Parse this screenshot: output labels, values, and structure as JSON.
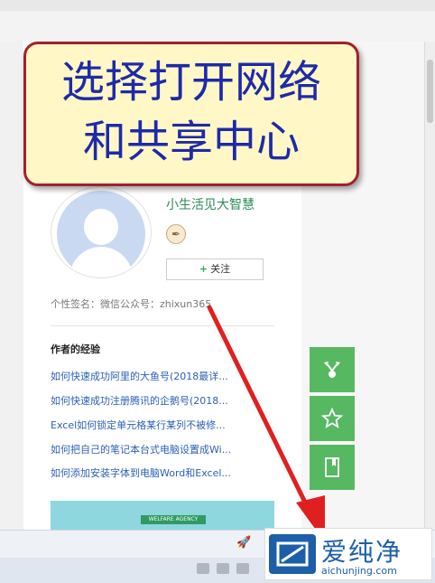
{
  "callout": {
    "line1": "选择打开网络",
    "line2": "和共享中心"
  },
  "author": {
    "name": "小生活见大智慧",
    "follow_label": "关注",
    "follow_plus": "+",
    "signature": "个性签名：微信公众号：zhixun365"
  },
  "experience": {
    "title": "作者的经验",
    "items": [
      "如何快速成功阿里的大鱼号(2018最详...",
      "如何快速成功注册腾讯的企鹅号(2018...",
      "Excel如何锁定单元格某行某列不被修...",
      "如何把自己的笔记本台式电脑设置成Wi...",
      "如何添加安装字体到电脑Word和Excel..."
    ]
  },
  "banner": {
    "ribbon_text": "WELFARE AGENCY"
  },
  "side_buttons": [
    {
      "icon": "share-icon"
    },
    {
      "icon": "star-icon"
    },
    {
      "icon": "bookmark-icon"
    }
  ],
  "watermark": {
    "title": "爱纯净",
    "url": "aichunjing.com"
  },
  "colors": {
    "callout_bg": "#fff8c6",
    "callout_border": "#a3202f",
    "callout_text": "#1e2aa8",
    "side_button": "#57b862",
    "author_name": "#2e8b57",
    "link": "#2c60b8",
    "arrow": "#e02020",
    "watermark": "#1c5fa8"
  }
}
